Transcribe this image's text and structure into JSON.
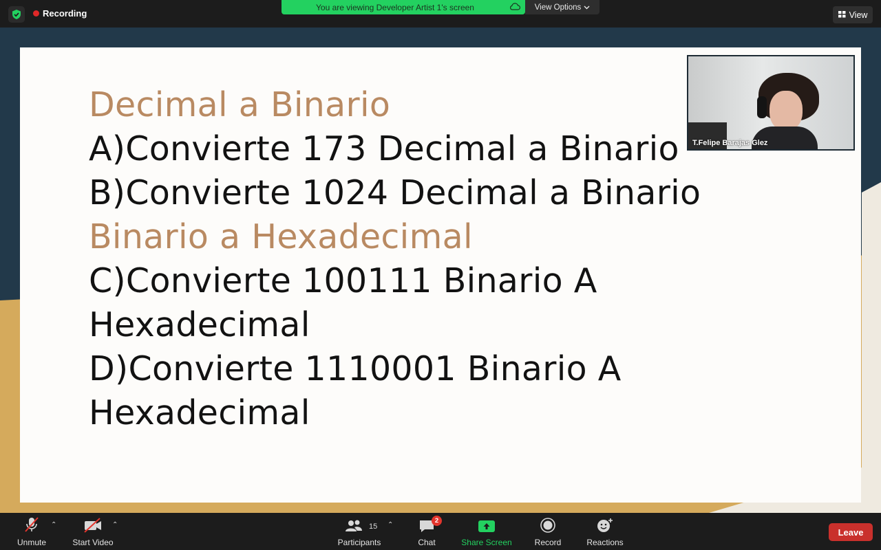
{
  "topbar": {
    "recording_label": "Recording",
    "banner_text": "You are viewing Developer Artist 1's screen",
    "view_options_label": "View Options",
    "view_label": "View"
  },
  "slide": {
    "lines": [
      {
        "text": "Decimal a Binario",
        "style": "heading"
      },
      {
        "text": "A)Convierte 173 Decimal a Binario",
        "style": "body"
      },
      {
        "text": "B)Convierte 1024 Decimal a Binario",
        "style": "body"
      },
      {
        "text": "Binario a Hexadecimal",
        "style": "heading"
      },
      {
        "text": "C)Convierte 100111 Binario A",
        "style": "body"
      },
      {
        "text": "Hexadecimal",
        "style": "body"
      },
      {
        "text": "D)Convierte 1110001 Binario A",
        "style": "body"
      },
      {
        "text": "Hexadecimal",
        "style": "body"
      }
    ]
  },
  "video": {
    "participant_name": "T.Felipe Barajas Glez"
  },
  "toolbar": {
    "unmute_label": "Unmute",
    "start_video_label": "Start Video",
    "participants_label": "Participants",
    "participants_count": "15",
    "chat_label": "Chat",
    "chat_badge": "2",
    "share_screen_label": "Share Screen",
    "record_label": "Record",
    "reactions_label": "Reactions",
    "leave_label": "Leave"
  },
  "colors": {
    "heading": "#b98a62",
    "body_text": "#121212",
    "banner": "#23d160",
    "leave": "#c9302c",
    "badge": "#e4352d"
  }
}
